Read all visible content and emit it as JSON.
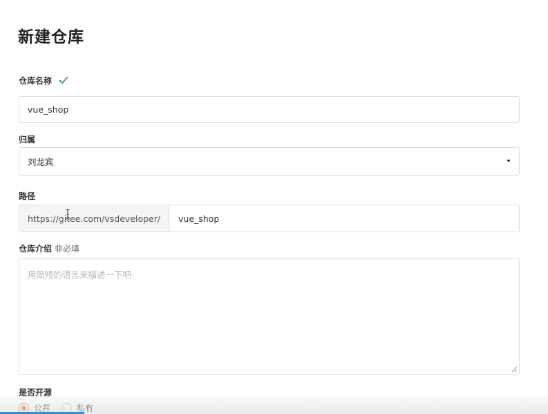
{
  "page": {
    "title": "新建仓库"
  },
  "repo_name": {
    "label": "仓库名称",
    "value": "vue_shop",
    "valid_icon": "check-icon"
  },
  "owner": {
    "label": "归属",
    "selected": "刘龙宾"
  },
  "path": {
    "label": "路径",
    "prefix": "https://gitee.com/vsdeveloper/",
    "value": "vue_shop"
  },
  "description": {
    "label": "仓库介绍",
    "optional_tag": "非必填",
    "placeholder": "用简短的语言来描述一下吧"
  },
  "visibility": {
    "label": "是否开源",
    "options": [
      {
        "label": "公开",
        "checked": true
      },
      {
        "label": "私有",
        "checked": false
      }
    ]
  },
  "colors": {
    "accent": "#e2782b",
    "check": "#3aa757",
    "scroll_indicator": "#2d8fd5"
  }
}
